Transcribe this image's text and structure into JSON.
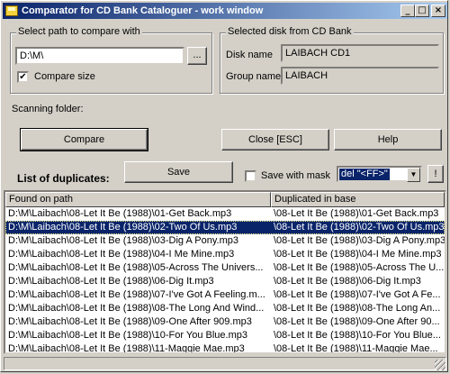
{
  "window": {
    "title": "Comparator for CD Bank Cataloguer - work window",
    "buttons": {
      "minimize": "_",
      "maximize": "□",
      "close": "×"
    }
  },
  "path_group": {
    "title": "Select path to compare with",
    "path_value": "D:\\M\\",
    "browse_label": "...",
    "compare_size_label": "Compare size",
    "compare_size_checked": true
  },
  "disk_group": {
    "title": "Selected disk from CD Bank",
    "disk_name_label": "Disk name",
    "disk_name_value": "LAIBACH CD1",
    "group_name_label": "Group name",
    "group_name_value": "LAIBACH"
  },
  "scanning_label": "Scanning folder:",
  "buttons": {
    "compare": "Compare",
    "close": "Close [ESC]",
    "help": "Help",
    "save": "Save",
    "exclaim": "!"
  },
  "duplicates_label": "List of duplicates:",
  "save_with_mask_label": "Save with mask",
  "mask_value": "del \"<FF>\"",
  "list": {
    "headers": [
      "Found on path",
      "Duplicated in base"
    ],
    "rows": [
      [
        "D:\\M\\Laibach\\08-Let It Be (1988)\\01-Get Back.mp3",
        "\\08-Let It Be (1988)\\01-Get Back.mp3"
      ],
      [
        "D:\\M\\Laibach\\08-Let It Be (1988)\\02-Two Of Us.mp3",
        "\\08-Let It Be (1988)\\02-Two Of Us.mp3"
      ],
      [
        "D:\\M\\Laibach\\08-Let It Be (1988)\\03-Dig A Pony.mp3",
        "\\08-Let It Be (1988)\\03-Dig A Pony.mp3"
      ],
      [
        "D:\\M\\Laibach\\08-Let It Be (1988)\\04-I Me Mine.mp3",
        "\\08-Let It Be (1988)\\04-I Me Mine.mp3"
      ],
      [
        "D:\\M\\Laibach\\08-Let It Be (1988)\\05-Across The Univers...",
        "\\08-Let It Be (1988)\\05-Across The U..."
      ],
      [
        "D:\\M\\Laibach\\08-Let It Be (1988)\\06-Dig It.mp3",
        "\\08-Let It Be (1988)\\06-Dig It.mp3"
      ],
      [
        "D:\\M\\Laibach\\08-Let It Be (1988)\\07-I've Got A Feeling.m...",
        "\\08-Let It Be (1988)\\07-I've Got A Fe..."
      ],
      [
        "D:\\M\\Laibach\\08-Let It Be (1988)\\08-The Long And Wind...",
        "\\08-Let It Be (1988)\\08-The Long An..."
      ],
      [
        "D:\\M\\Laibach\\08-Let It Be (1988)\\09-One After 909.mp3",
        "\\08-Let It Be (1988)\\09-One After 90..."
      ],
      [
        "D:\\M\\Laibach\\08-Let It Be (1988)\\10-For You Blue.mp3",
        "\\08-Let It Be (1988)\\10-For You Blue..."
      ],
      [
        "D:\\M\\Laibach\\08-Let It Be (1988)\\11-Maggie Mae.mp3",
        "\\08-Let It Be (1988)\\11-Maggie Mae..."
      ]
    ],
    "selected_index": 1
  }
}
